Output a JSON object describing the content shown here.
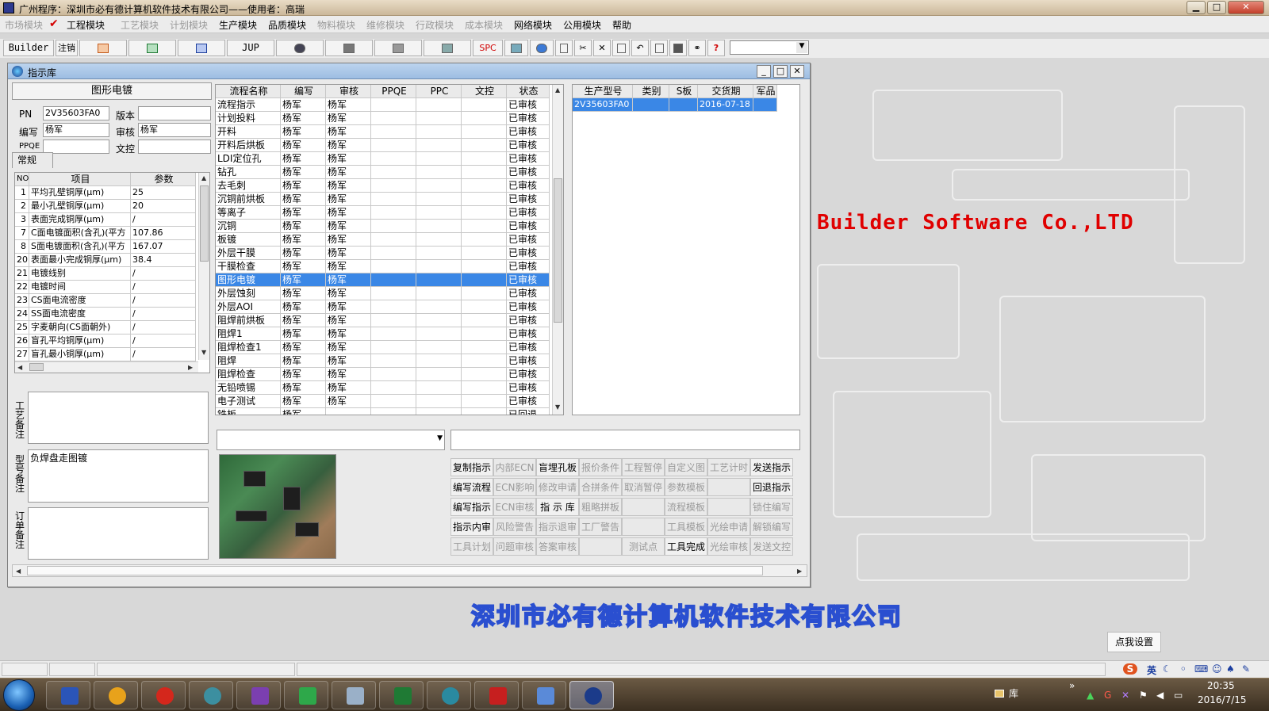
{
  "window": {
    "title": "广州程序：深圳市必有德计算机软件技术有限公司——使用者：高瑞",
    "min": "▁",
    "max": "□",
    "close": "✕"
  },
  "menu": [
    {
      "label": "市场模块",
      "state": "dim"
    },
    {
      "label": "工程模块",
      "state": "active"
    },
    {
      "label": "工艺模块",
      "state": "dim"
    },
    {
      "label": "计划模块",
      "state": "dim"
    },
    {
      "label": "生产模块",
      "state": "active"
    },
    {
      "label": "品质模块",
      "state": "active"
    },
    {
      "label": "物料模块",
      "state": "dim"
    },
    {
      "label": "维修模块",
      "state": "dim"
    },
    {
      "label": "行政模块",
      "state": "dim"
    },
    {
      "label": "成本模块",
      "state": "dim"
    },
    {
      "label": "网络模块",
      "state": "active"
    },
    {
      "label": "公用模块",
      "state": "active"
    },
    {
      "label": "帮助",
      "state": "active"
    }
  ],
  "toolbar": {
    "builder": "Builder",
    "logout": "注销",
    "jup": "JUP",
    "spc": "SPC",
    "help": "?"
  },
  "dialog": {
    "title": "指示库",
    "min": "_",
    "max": "□",
    "close": "✕",
    "left_header": "图形电镀",
    "fields": {
      "pn_label": "PN",
      "pn_value": "2V35603FA0",
      "version_label": "版本",
      "version_value": "",
      "editor_label": "编写",
      "editor_value": "杨军",
      "reviewer_label": "审核",
      "reviewer_value": "杨军",
      "ppqe_label": "PPQE",
      "ppqe_value": "",
      "doc_label": "文控",
      "doc_value": ""
    },
    "tab_general": "常规",
    "param_headers": [
      "NO",
      "项目",
      "参数"
    ],
    "params": [
      {
        "no": "1",
        "item": "平均孔壁铜厚(μm)",
        "value": "25"
      },
      {
        "no": "2",
        "item": "最小孔壁铜厚(μm)",
        "value": "20"
      },
      {
        "no": "3",
        "item": "表面完成铜厚(μm)",
        "value": "/"
      },
      {
        "no": "7",
        "item": "C面电镀面积(含孔)(平方",
        "value": "107.86"
      },
      {
        "no": "8",
        "item": "S面电镀面积(含孔)(平方",
        "value": "167.07"
      },
      {
        "no": "20",
        "item": "表面最小完成铜厚(μm)",
        "value": "38.4"
      },
      {
        "no": "21",
        "item": "电镀线别",
        "value": "/"
      },
      {
        "no": "22",
        "item": "电镀时间",
        "value": "/"
      },
      {
        "no": "23",
        "item": "CS面电流密度",
        "value": "/"
      },
      {
        "no": "24",
        "item": "SS面电流密度",
        "value": "/"
      },
      {
        "no": "25",
        "item": "字麦朝向(CS面朝外)",
        "value": "/"
      },
      {
        "no": "26",
        "item": "盲孔平均铜厚(μm)",
        "value": "/"
      },
      {
        "no": "27",
        "item": "盲孔最小铜厚(μm)",
        "value": "/"
      }
    ],
    "notes": [
      {
        "label": "工艺备注",
        "text": ""
      },
      {
        "label": "型号备注",
        "text": "负焊盘走图镀"
      },
      {
        "label": "订单备注",
        "text": ""
      }
    ],
    "flow_headers": [
      "流程名称",
      "编写",
      "审核",
      "PPQE",
      "PPC",
      "文控",
      "状态"
    ],
    "flows": [
      {
        "name": "流程指示",
        "editor": "杨军",
        "reviewer": "杨军",
        "status": "已审核"
      },
      {
        "name": "计划投料",
        "editor": "杨军",
        "reviewer": "杨军",
        "status": "已审核"
      },
      {
        "name": "开料",
        "editor": "杨军",
        "reviewer": "杨军",
        "status": "已审核"
      },
      {
        "name": "开料后烘板",
        "editor": "杨军",
        "reviewer": "杨军",
        "status": "已审核"
      },
      {
        "name": "LDI定位孔",
        "editor": "杨军",
        "reviewer": "杨军",
        "status": "已审核"
      },
      {
        "name": "钻孔",
        "editor": "杨军",
        "reviewer": "杨军",
        "status": "已审核"
      },
      {
        "name": "去毛刺",
        "editor": "杨军",
        "reviewer": "杨军",
        "status": "已审核"
      },
      {
        "name": "沉铜前烘板",
        "editor": "杨军",
        "reviewer": "杨军",
        "status": "已审核"
      },
      {
        "name": "等离子",
        "editor": "杨军",
        "reviewer": "杨军",
        "status": "已审核"
      },
      {
        "name": "沉铜",
        "editor": "杨军",
        "reviewer": "杨军",
        "status": "已审核"
      },
      {
        "name": "板镀",
        "editor": "杨军",
        "reviewer": "杨军",
        "status": "已审核"
      },
      {
        "name": "外层干膜",
        "editor": "杨军",
        "reviewer": "杨军",
        "status": "已审核"
      },
      {
        "name": "干膜检查",
        "editor": "杨军",
        "reviewer": "杨军",
        "status": "已审核"
      },
      {
        "name": "图形电镀",
        "editor": "杨军",
        "reviewer": "杨军",
        "status": "已审核",
        "selected": true
      },
      {
        "name": "外层蚀刻",
        "editor": "杨军",
        "reviewer": "杨军",
        "status": "已审核"
      },
      {
        "name": "外层AOI",
        "editor": "杨军",
        "reviewer": "杨军",
        "status": "已审核"
      },
      {
        "name": "阻焊前烘板",
        "editor": "杨军",
        "reviewer": "杨军",
        "status": "已审核"
      },
      {
        "name": "阻焊1",
        "editor": "杨军",
        "reviewer": "杨军",
        "status": "已审核"
      },
      {
        "name": "阻焊检查1",
        "editor": "杨军",
        "reviewer": "杨军",
        "status": "已审核"
      },
      {
        "name": "阻焊",
        "editor": "杨军",
        "reviewer": "杨军",
        "status": "已审核"
      },
      {
        "name": "阻焊检查",
        "editor": "杨军",
        "reviewer": "杨军",
        "status": "已审核"
      },
      {
        "name": "无铅喷锡",
        "editor": "杨军",
        "reviewer": "杨军",
        "status": "已审核"
      },
      {
        "name": "电子测试",
        "editor": "杨军",
        "reviewer": "杨军",
        "status": "已审核"
      },
      {
        "name": "铣板",
        "editor": "杨军",
        "reviewer": "",
        "status": "已回退"
      }
    ],
    "model_headers": [
      "生产型号",
      "类别",
      "S板",
      "交货期",
      "军品"
    ],
    "models": [
      {
        "model": "2V35603FA0",
        "category": "",
        "s_board": "",
        "delivery": "2016-07-18",
        "military": ""
      }
    ],
    "actions": [
      [
        {
          "label": "复制指示",
          "on": true
        },
        {
          "label": "内部ECN",
          "on": false
        },
        {
          "label": "盲埋孔板",
          "on": true
        },
        {
          "label": "报价条件",
          "on": false
        },
        {
          "label": "工程暂停",
          "on": false
        },
        {
          "label": "自定义图",
          "on": false
        },
        {
          "label": "工艺计时",
          "on": false
        },
        {
          "label": "发送指示",
          "on": true
        }
      ],
      [
        {
          "label": "编写流程",
          "on": true
        },
        {
          "label": "ECN影响",
          "on": false
        },
        {
          "label": "修改申请",
          "on": false
        },
        {
          "label": "合拼条件",
          "on": false
        },
        {
          "label": "取消暂停",
          "on": false
        },
        {
          "label": "参数模板",
          "on": false
        },
        {
          "label": "",
          "on": false
        },
        {
          "label": "回退指示",
          "on": true
        }
      ],
      [
        {
          "label": "编写指示",
          "on": true
        },
        {
          "label": "ECN审核",
          "on": false
        },
        {
          "label": "指 示 库",
          "on": true
        },
        {
          "label": "粗略拼板",
          "on": false
        },
        {
          "label": "",
          "on": false
        },
        {
          "label": "流程模板",
          "on": false
        },
        {
          "label": "",
          "on": false
        },
        {
          "label": "锁住编写",
          "on": false
        }
      ],
      [
        {
          "label": "指示内审",
          "on": true
        },
        {
          "label": "风险警告",
          "on": false
        },
        {
          "label": "指示退审",
          "on": false
        },
        {
          "label": "工厂警告",
          "on": false
        },
        {
          "label": "",
          "on": false
        },
        {
          "label": "工具模板",
          "on": false
        },
        {
          "label": "光绘申请",
          "on": false
        },
        {
          "label": "解锁编写",
          "on": false
        }
      ],
      [
        {
          "label": "工具计划",
          "on": false
        },
        {
          "label": "问题审核",
          "on": false
        },
        {
          "label": "答案审核",
          "on": false
        },
        {
          "label": "",
          "on": false
        },
        {
          "label": "测试点",
          "on": false
        },
        {
          "label": "工具完成",
          "on": true
        },
        {
          "label": "光绘审核",
          "on": false
        },
        {
          "label": "发送文控",
          "on": false
        }
      ]
    ]
  },
  "desktop": {
    "brand": "Builder Software Co.,LTD",
    "company": "深圳市必有德计算机软件技术有限公司",
    "setup_button": "点我设置"
  },
  "ime": {
    "lang": "英",
    "logo": "S"
  },
  "taskbar": {
    "folder_label": "库",
    "time": "20:35",
    "date": "2016/7/15",
    "expand": "»"
  },
  "colors": {
    "selection": "#3a87e6",
    "brand_red": "#e00000",
    "company_blue": "#2a4fd0"
  }
}
